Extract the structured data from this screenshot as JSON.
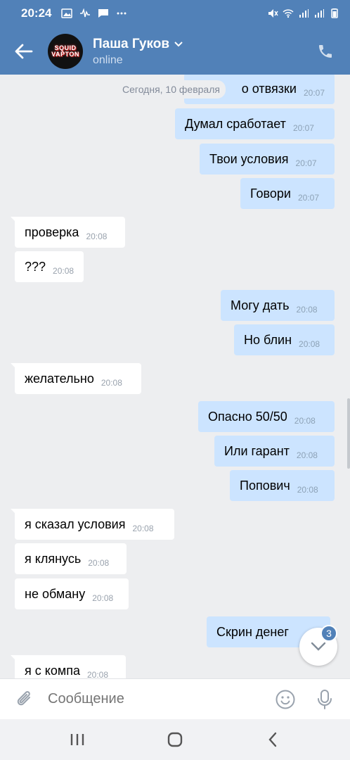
{
  "status_bar": {
    "time": "20:24"
  },
  "header": {
    "name": "Паша Гуков",
    "status": "online",
    "avatar_text": "SQUIDVAPTON"
  },
  "chat": {
    "date_separator": "Сегодня, 10 февраля",
    "messages": [
      {
        "dir": "out",
        "text": "о отвязки",
        "time": "20:07"
      },
      {
        "dir": "out",
        "text": "Думал сработает",
        "time": "20:07"
      },
      {
        "dir": "out",
        "text": "Твои условия",
        "time": "20:07"
      },
      {
        "dir": "out",
        "text": "Говори",
        "time": "20:07"
      },
      {
        "dir": "in",
        "text": "проверка",
        "time": "20:08"
      },
      {
        "dir": "in",
        "text": "???",
        "time": "20:08"
      },
      {
        "dir": "out",
        "text": "Могу дать",
        "time": "20:08"
      },
      {
        "dir": "out",
        "text": "Но блин",
        "time": "20:08"
      },
      {
        "dir": "in",
        "text": "желательно",
        "time": "20:08"
      },
      {
        "dir": "out",
        "text": "Опасно 50/50",
        "time": "20:08"
      },
      {
        "dir": "out",
        "text": "Или гарант",
        "time": "20:08"
      },
      {
        "dir": "out",
        "text": "Попович",
        "time": "20:08"
      },
      {
        "dir": "in",
        "text": "я сказал условия",
        "time": "20:08"
      },
      {
        "dir": "in",
        "text": "я клянусь",
        "time": "20:08"
      },
      {
        "dir": "in",
        "text": "не обману",
        "time": "20:08"
      },
      {
        "dir": "out",
        "text": "Скрин денег",
        "time": ""
      },
      {
        "dir": "in",
        "text": "я с компа",
        "time": "20:08"
      }
    ],
    "unread_count": "3"
  },
  "input": {
    "placeholder": "Сообщение"
  },
  "colors": {
    "header": "#5181b8",
    "outgoing": "#cce4ff",
    "incoming": "#ffffff",
    "background": "#edeef0"
  }
}
